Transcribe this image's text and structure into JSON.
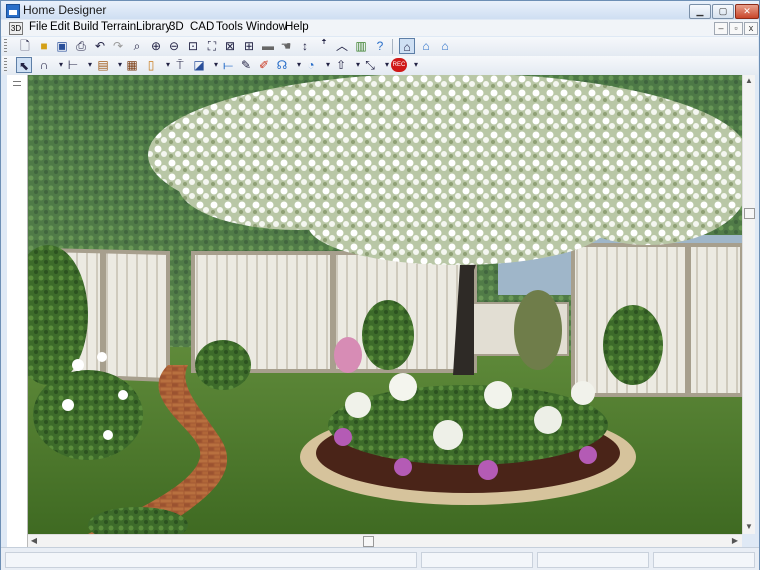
{
  "window": {
    "title": "Home Designer",
    "controls": [
      "min",
      "max",
      "close"
    ]
  },
  "menu": [
    "File",
    "Edit",
    "Build",
    "Terrain",
    "Library",
    "3D",
    "CAD",
    "Tools",
    "Window",
    "Help"
  ],
  "toolbar_top": [
    "new-file-icon",
    "open-folder-icon",
    "save-icon",
    "print-icon",
    "undo-icon",
    "redo-icon",
    "zoom-icon",
    "zoom-in-icon",
    "zoom-out-icon",
    "fill-window-icon",
    "zoom-extents-icon",
    "zoom-all-icon",
    "add-icon",
    "camera-icon",
    "pan-icon",
    "up-down-arrow-icon",
    "roof-icon",
    "library-icon",
    "help-icon",
    "plan-view-icon",
    "elevation-view-icon",
    "perspective-view-icon"
  ],
  "toolbar_bottom": [
    "select-icon",
    "arc-tool-icon",
    "wall-tool-icon",
    "cabinet-tool-icon",
    "door-tool-icon",
    "stair-tool-icon",
    "window-tool-icon",
    "roof-tool-icon",
    "dimension-tool-icon",
    "paint-icon",
    "text-tool-icon",
    "color-tool-icon",
    "material-icon",
    "camera-tool-icon",
    "arrow-tool-icon",
    "terrain-tool-icon",
    "record-icon"
  ],
  "record_label": "REC",
  "colors": {
    "accent": "#2a6fc9",
    "titlebar": "#dbe6f4",
    "record": "#d01818"
  }
}
